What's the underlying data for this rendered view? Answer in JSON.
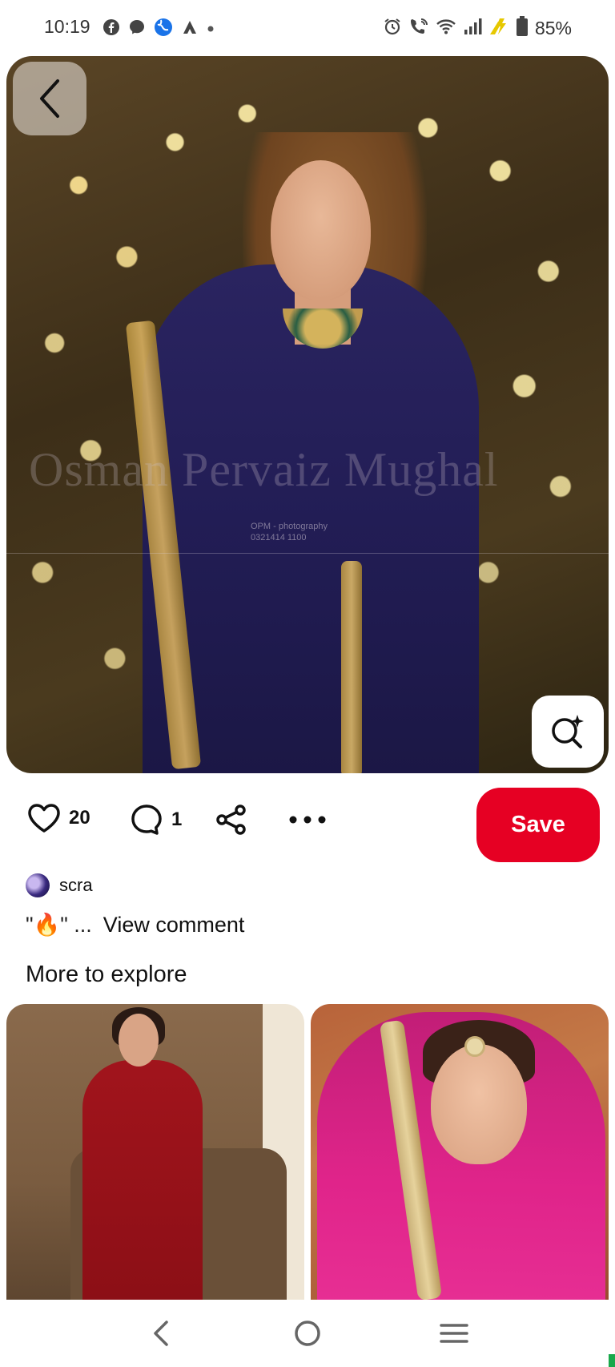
{
  "status_bar": {
    "time": "10:19",
    "battery_pct": "85%",
    "left_icons": [
      "facebook-icon",
      "messenger-icon",
      "browser-icon",
      "maps-icon",
      "dot-icon"
    ],
    "right_icons": [
      "alarm-icon",
      "wifi-call-icon",
      "wifi-icon",
      "signal-icon",
      "charging-icon",
      "battery-icon"
    ]
  },
  "pin": {
    "watermark_text": "Osman Pervaiz Mughal",
    "watermark_small_1": "OPM - photography",
    "watermark_small_2": "0321414 1100",
    "like_count": "20",
    "comment_count": "1",
    "save_label": "Save"
  },
  "comment": {
    "author": "scra",
    "preview": "\"🔥\" ...",
    "view_label": "View comment"
  },
  "more_to_explore": {
    "title": "More to explore"
  },
  "colors": {
    "accent": "#e60023",
    "text": "#111111"
  }
}
